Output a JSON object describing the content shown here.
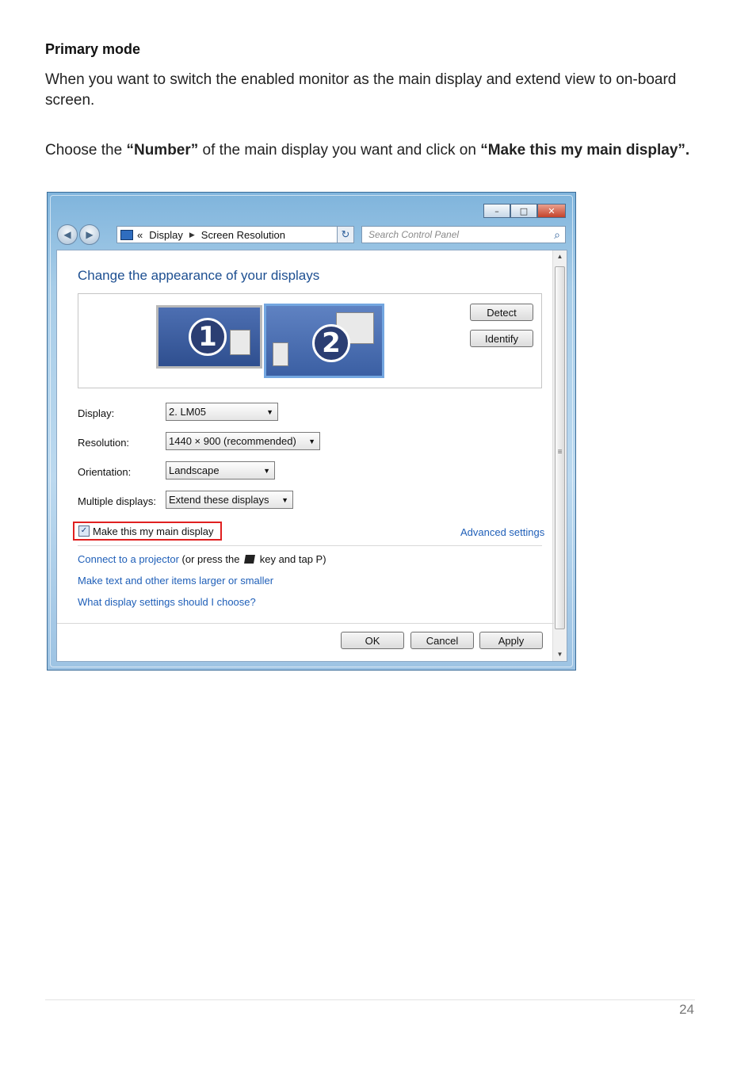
{
  "doc": {
    "heading": "Primary mode",
    "para1": "When you want to switch the enabled monitor as the main display and extend view to on-board screen.",
    "para2_a": "Choose the ",
    "para2_b": "“Number”",
    "para2_c": " of the main display you want and click on ",
    "para2_d": "“Make this my main display”.",
    "page_number": "24"
  },
  "window": {
    "caption_buttons": [
      "–",
      "□",
      "✕"
    ],
    "nav_back": "◀",
    "nav_forward": "▶",
    "address": {
      "chevrons": "«",
      "crumb1": "Display",
      "sep": "▶",
      "crumb2": "Screen Resolution",
      "dropdown": "▼"
    },
    "refresh_glyph": "↻",
    "search_placeholder": "Search Control Panel",
    "search_icon": "⌕"
  },
  "content": {
    "title": "Change the appearance of your displays",
    "monitor1_number": "1",
    "monitor2_number": "2",
    "detect_label": "Detect",
    "identify_label": "Identify",
    "display_label": "Display:",
    "display_value": "2. LM05",
    "resolution_label": "Resolution:",
    "resolution_value": "1440 × 900 (recommended)",
    "orientation_label": "Orientation:",
    "orientation_value": "Landscape",
    "multiple_label": "Multiple displays:",
    "multiple_value": "Extend these displays",
    "main_display_checkbox": "Make this my main display",
    "main_display_checked": true,
    "advanced_settings": "Advanced settings",
    "projector_link": "Connect to a projector",
    "projector_text_a": " (or press the ",
    "projector_text_b": " key and tap P)",
    "text_size_link": "Make text and other items larger or smaller",
    "help_link": "What display settings should I choose?",
    "ok_label": "OK",
    "cancel_label": "Cancel",
    "apply_label": "Apply",
    "dropdown_glyph": "▼",
    "check_glyph": "✓"
  },
  "colors": {
    "link": "#1f5fb8",
    "title_blue": "#1d4f91",
    "highlight_red": "#e02020"
  }
}
